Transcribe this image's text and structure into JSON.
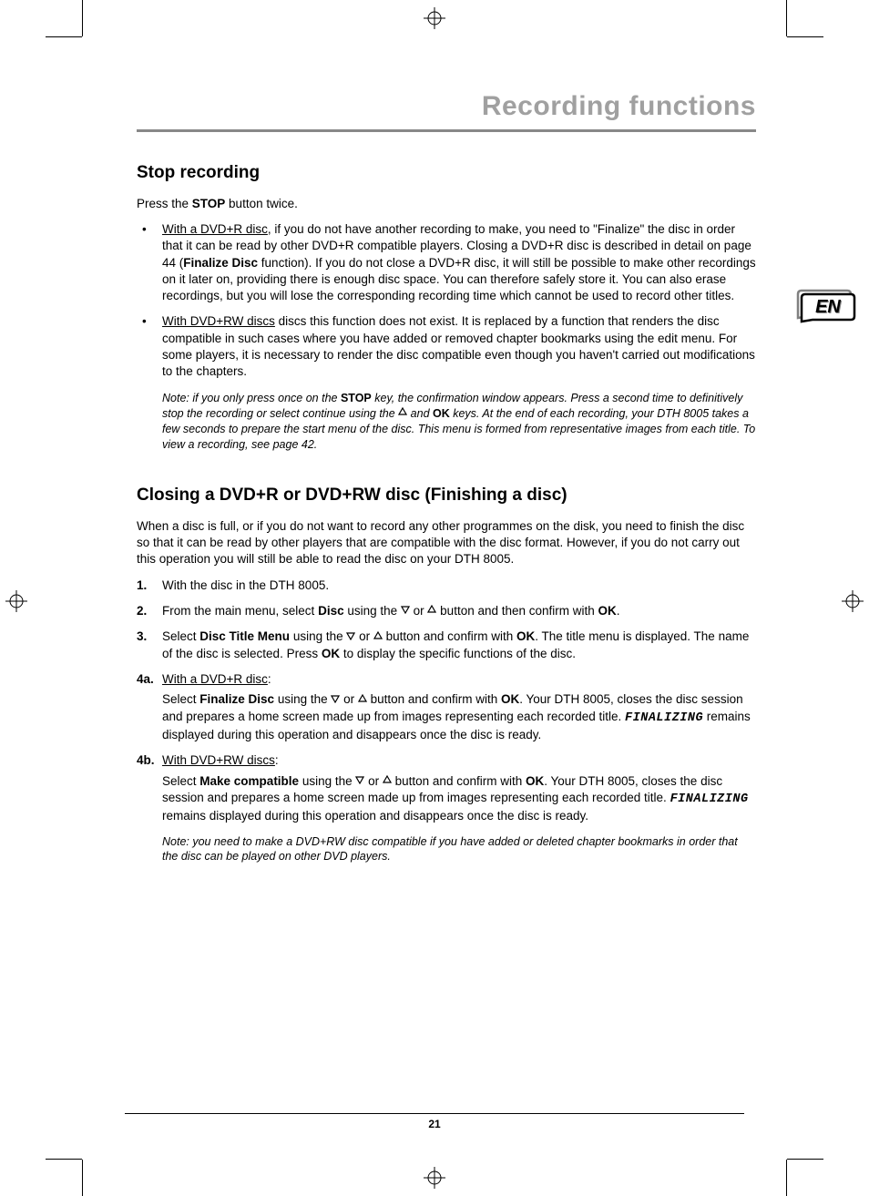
{
  "section_title": "Recording functions",
  "lang_badge": "EN",
  "page_number": "21",
  "h1": "Stop recording",
  "p1_pre": "Press the ",
  "p1_bold": "STOP",
  "p1_post": " button twice.",
  "bullet1_u": "With a DVD+R disc",
  "bullet1_a": ", if you do not have another recording to make, you need to \"Finalize\" the disc in order that it can be read by other DVD+R compatible players. Closing a DVD+R disc is described in detail on page 44 (",
  "bullet1_b": "Finalize Disc",
  "bullet1_c": " function). If you do not close a DVD+R disc, it will still be possible to make other recordings on it later on, providing there is enough disc space. You can therefore safely store it. You can also erase recordings, but you will lose the corresponding recording time which cannot be used to record other titles.",
  "bullet2_u": "With DVD+RW discs",
  "bullet2_a": " discs this function does not exist. It is replaced by a function that renders the disc compatible in such cases where you have added or removed chapter bookmarks using the edit menu. For some players, it is necessary to render the disc compatible even though you haven't carried out modifications to the chapters.",
  "note1_a": "Note: if you only press once on the ",
  "note1_b": "STOP",
  "note1_c": " key, the confirmation window appears. Press a second time to definitively stop the recording or select continue using the ",
  "note1_d": " and ",
  "note1_e": "OK",
  "note1_f": " keys. At the end of each recording, your DTH 8005 takes a few seconds to prepare the start menu of the disc. This menu is formed from representative images from each title. To view a recording, see page 42.",
  "h2": "Closing a DVD+R or DVD+RW disc (Finishing a disc)",
  "p2": "When a disc is full, or if you do not want to record any other programmes on the disk, you need to finish the disc so that it can be read by other players that are compatible with the disc format. However, if you do not carry out this operation you will still be able to read the disc on your DTH 8005.",
  "step1_num": "1.",
  "step1": "With the disc in the DTH 8005.",
  "step2_num": "2.",
  "step2_a": "From the main menu, select ",
  "step2_b": "Disc",
  "step2_c": " using the  ",
  "step2_d": "  or  ",
  "step2_e": "  button and then confirm with ",
  "step2_f": "OK",
  "step2_g": ".",
  "step3_num": "3.",
  "step3_a": "Select ",
  "step3_b": "Disc Title Menu",
  "step3_c": " using the  ",
  "step3_d": "  or  ",
  "step3_e": "  button and confirm with ",
  "step3_f": "OK",
  "step3_g": ". The title menu is displayed. The name of the disc is selected. Press ",
  "step3_h": "OK",
  "step3_i": " to display the specific functions of the disc.",
  "s4a_num": "4a.",
  "s4a_u": "With a DVD+R disc",
  "s4a_colon": ":",
  "s4a_a": "Select ",
  "s4a_b": "Finalize Disc",
  "s4a_c": " using the  ",
  "s4a_d": "  or  ",
  "s4a_e": "  button and confirm with ",
  "s4a_f": "OK",
  "s4a_g": ". Your DTH 8005, closes the disc session and prepares a home screen made up from images representing each recorded title. ",
  "s4a_lcd": "FINALIZING",
  "s4a_h": " remains displayed during this operation and disappears once the disc is ready.",
  "s4b_num": "4b.",
  "s4b_u": "With DVD+RW discs",
  "s4b_colon": ":",
  "s4b_a": "Select ",
  "s4b_b": "Make compatible",
  "s4b_c": " using the  ",
  "s4b_d": "  or  ",
  "s4b_e": "  button and confirm with ",
  "s4b_f": "OK",
  "s4b_g": ". Your DTH 8005, closes the disc session and prepares a home screen made up from images representing each recorded title. ",
  "s4b_lcd": "FINALIZING",
  "s4b_h": " remains displayed during this operation and disappears once the disc is ready.",
  "note2": "Note: you need to make a DVD+RW disc compatible if you have added or deleted chapter bookmarks in order that the disc can be played on other DVD players."
}
